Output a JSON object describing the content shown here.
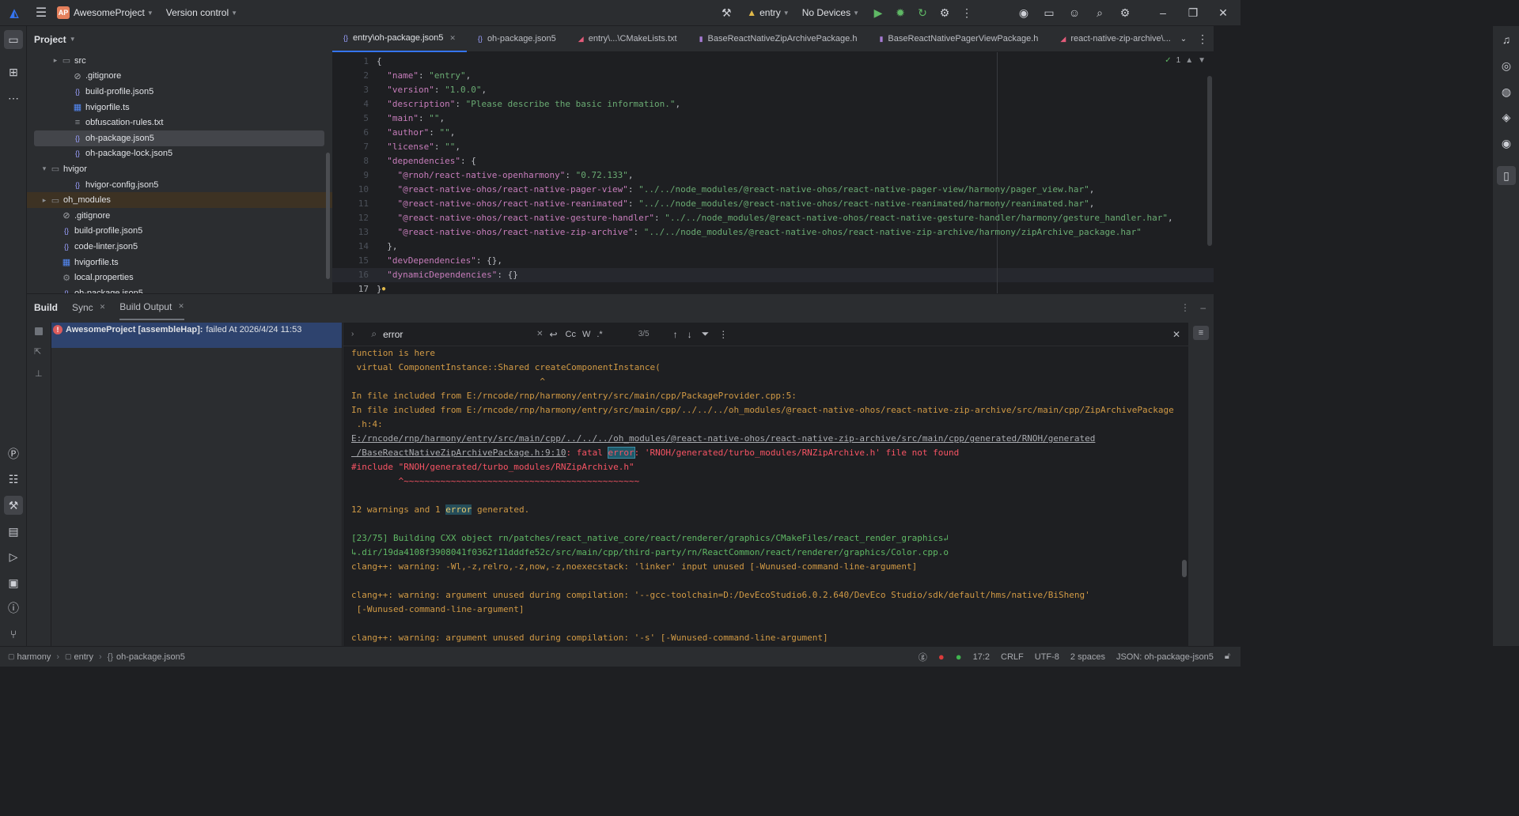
{
  "topbar": {
    "project_initials": "AP",
    "project_name": "AwesomeProject",
    "version_control": "Version control",
    "module": "entry",
    "devices": "No Devices"
  },
  "project_panel": {
    "title": "Project",
    "items": [
      {
        "label": "src",
        "type": "folder",
        "depth": 2,
        "arrow": "▸"
      },
      {
        "label": ".gitignore",
        "type": "ignore",
        "depth": 3,
        "arrow": ""
      },
      {
        "label": "build-profile.json5",
        "type": "json",
        "depth": 3,
        "arrow": ""
      },
      {
        "label": "hvigorfile.ts",
        "type": "ts",
        "depth": 3,
        "arrow": ""
      },
      {
        "label": "obfuscation-rules.txt",
        "type": "txt",
        "depth": 3,
        "arrow": ""
      },
      {
        "label": "oh-package.json5",
        "type": "json",
        "depth": 3,
        "arrow": "",
        "selected": true
      },
      {
        "label": "oh-package-lock.json5",
        "type": "json",
        "depth": 3,
        "arrow": ""
      },
      {
        "label": "hvigor",
        "type": "folder",
        "depth": 1,
        "arrow": "▾"
      },
      {
        "label": "hvigor-config.json5",
        "type": "json",
        "depth": 3,
        "arrow": ""
      },
      {
        "label": "oh_modules",
        "type": "folder",
        "depth": 1,
        "arrow": "▸",
        "excluded": true
      },
      {
        "label": ".gitignore",
        "type": "ignore",
        "depth": 2,
        "arrow": ""
      },
      {
        "label": "build-profile.json5",
        "type": "json",
        "depth": 2,
        "arrow": ""
      },
      {
        "label": "code-linter.json5",
        "type": "json",
        "depth": 2,
        "arrow": ""
      },
      {
        "label": "hvigorfile.ts",
        "type": "ts",
        "depth": 2,
        "arrow": ""
      },
      {
        "label": "local.properties",
        "type": "gear",
        "depth": 2,
        "arrow": ""
      },
      {
        "label": "oh-package.json5",
        "type": "json",
        "depth": 2,
        "arrow": ""
      }
    ]
  },
  "editor_tabs": [
    {
      "label": "entry\\oh-package.json5",
      "active": true,
      "closable": true
    },
    {
      "label": "oh-package.json5",
      "active": false
    },
    {
      "label": "entry\\...\\CMakeLists.txt",
      "active": false
    },
    {
      "label": "BaseReactNativeZipArchivePackage.h",
      "active": false
    },
    {
      "label": "BaseReactNativePagerViewPackage.h",
      "active": false
    },
    {
      "label": "react-native-zip-archive\\...",
      "active": false
    }
  ],
  "editor": {
    "inspection_count": "1",
    "lines": [
      {
        "n": "1",
        "code": "{"
      },
      {
        "n": "2",
        "code": "  \"name\": \"entry\","
      },
      {
        "n": "3",
        "code": "  \"version\": \"1.0.0\","
      },
      {
        "n": "4",
        "code": "  \"description\": \"Please describe the basic information.\","
      },
      {
        "n": "5",
        "code": "  \"main\": \"\","
      },
      {
        "n": "6",
        "code": "  \"author\": \"\","
      },
      {
        "n": "7",
        "code": "  \"license\": \"\","
      },
      {
        "n": "8",
        "code": "  \"dependencies\": {"
      },
      {
        "n": "9",
        "code": "    \"@rnoh/react-native-openharmony\": \"0.72.133\","
      },
      {
        "n": "10",
        "code": "    \"@react-native-ohos/react-native-pager-view\": \"../../node_modules/@react-native-ohos/react-native-pager-view/harmony/pager_view.har\","
      },
      {
        "n": "11",
        "code": "    \"@react-native-ohos/react-native-reanimated\": \"../../node_modules/@react-native-ohos/react-native-reanimated/harmony/reanimated.har\","
      },
      {
        "n": "12",
        "code": "    \"@react-native-ohos/react-native-gesture-handler\": \"../../node_modules/@react-native-ohos/react-native-gesture-handler/harmony/gesture_handler.har\","
      },
      {
        "n": "13",
        "code": "    \"@react-native-ohos/react-native-zip-archive\": \"../../node_modules/@react-native-ohos/react-native-zip-archive/harmony/zipArchive_package.har\""
      },
      {
        "n": "14",
        "code": "  },"
      },
      {
        "n": "15",
        "code": "  \"devDependencies\": {},"
      },
      {
        "n": "16",
        "code": "  \"dynamicDependencies\": {}"
      },
      {
        "n": "17",
        "code": "}"
      }
    ]
  },
  "bottom": {
    "tabs": [
      "Build",
      "Sync",
      "Build Output"
    ],
    "build_item_title": "AwesomeProject [assembleHap]:",
    "build_item_status": "failed At 2026/4/24 11:53",
    "search_value": "error",
    "search_opts": [
      "Cc",
      "W",
      ".*"
    ],
    "search_count": "3/5",
    "output": [
      {
        "text": "function is here",
        "cls": "o-warn"
      },
      {
        "text": " virtual ComponentInstance::Shared createComponentInstance(",
        "cls": "o-warn"
      },
      {
        "text": "                                    ^",
        "cls": "o-warn"
      },
      {
        "text": "In file included from E:/rncode/rnp/harmony/entry/src/main/cpp/PackageProvider.cpp:5:",
        "cls": "o-warn"
      },
      {
        "text": "In file included from E:/rncode/rnp/harmony/entry/src/main/cpp/../../../oh_modules/@react-native-ohos/react-native-zip-archive/src/main/cpp/ZipArchivePackage",
        "cls": "o-warn"
      },
      {
        "text": " .h:4:",
        "cls": "o-warn"
      },
      {
        "text": "E:/rncode/rnp/harmony/entry/src/main/cpp/../../../oh_modules/@react-native-ohos/react-native-zip-archive/src/main/cpp/generated/RNOH/generated",
        "cls": "o-gry"
      },
      {
        "text": " /BaseReactNativeZipArchivePackage.h:9:10",
        "cls": "o-gry",
        "suffix": ": fatal ",
        "hl": "error",
        "rest": ": 'RNOH/generated/turbo_modules/RNZipArchive.h' file not found"
      },
      {
        "text": "#include \"RNOH/generated/turbo_modules/RNZipArchive.h\"",
        "cls": "o-err"
      },
      {
        "text": "         ^~~~~~~~~~~~~~~~~~~~~~~~~~~~~~~~~~~~~~~~~~~~~~",
        "cls": "o-err"
      },
      {
        "text": "",
        "cls": "o-gry"
      },
      {
        "text": "12 warnings and 1 ",
        "cls": "o-warn",
        "hl2": "error",
        "rest2": " generated."
      },
      {
        "text": "",
        "cls": "o-gry"
      },
      {
        "text": "[23/75] Building CXX object rn/patches/react_native_core/react/renderer/graphics/CMakeFiles/react_render_graphics↲",
        "cls": "o-grn"
      },
      {
        "text": "↳.dir/19da4108f3908041f0362f11dddfe52c/src/main/cpp/third-party/rn/ReactCommon/react/renderer/graphics/Color.cpp.o",
        "cls": "o-grn"
      },
      {
        "text": "clang++: warning: -Wl,-z,relro,-z,now,-z,noexecstack: 'linker' input unused [-Wunused-command-line-argument]",
        "cls": "o-warn"
      },
      {
        "text": "",
        "cls": "o-gry"
      },
      {
        "text": "clang++: warning: argument unused during compilation: '--gcc-toolchain=D:/DevEcoStudio6.0.2.640/DevEco Studio/sdk/default/hms/native/BiSheng'",
        "cls": "o-warn"
      },
      {
        "text": " [-Wunused-command-line-argument]",
        "cls": "o-warn"
      },
      {
        "text": "",
        "cls": "o-gry"
      },
      {
        "text": "clang++: warning: argument unused during compilation: '-s' [-Wunused-command-line-argument]",
        "cls": "o-warn"
      }
    ]
  },
  "statusbar": {
    "crumbs": [
      "harmony",
      "entry",
      "oh-package.json5"
    ],
    "position": "17:2",
    "line_sep": "CRLF",
    "encoding": "UTF-8",
    "indent": "2 spaces",
    "schema": "JSON: oh-package-json5"
  }
}
